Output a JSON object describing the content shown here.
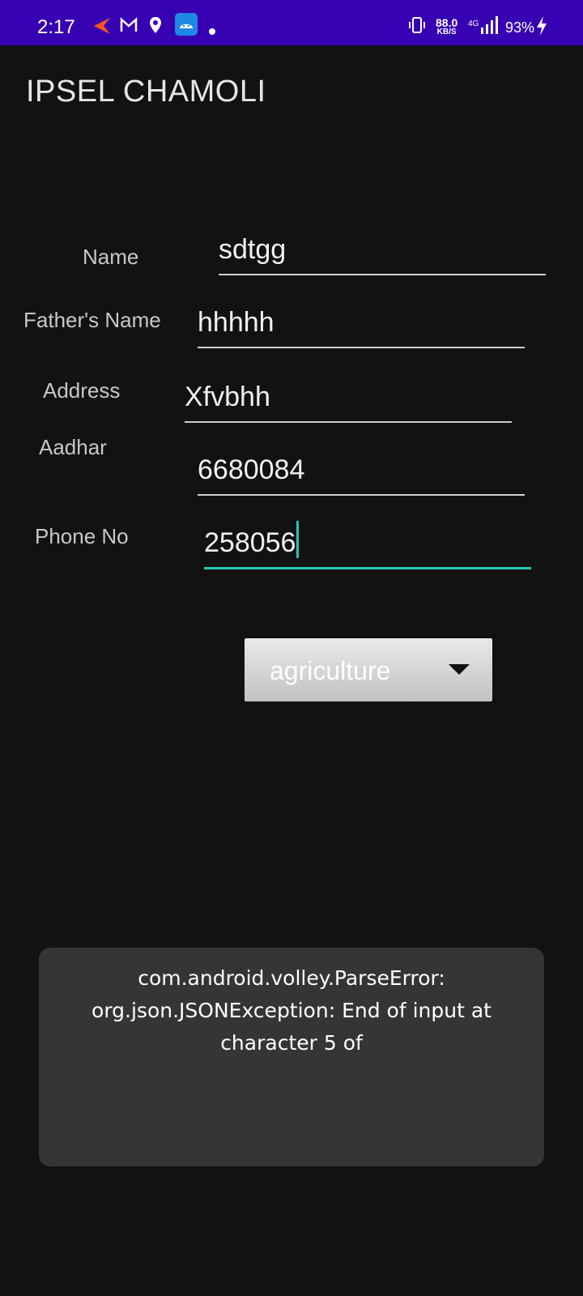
{
  "status_bar": {
    "time": "2:17",
    "net_speed_value": "88.0",
    "net_speed_unit": "KB/S",
    "network_type": "4G",
    "battery": "93%",
    "icons": [
      "kite-icon",
      "gmail-icon",
      "location-icon",
      "android-icon",
      "dot-icon",
      "vibrate-icon",
      "signal-icon",
      "charging-icon"
    ]
  },
  "app": {
    "title": "IPSEL CHAMOLI"
  },
  "form": {
    "name_label": "Name",
    "name_value": "sdtgg",
    "father_label": "Father's Name",
    "father_value": "hhhhh",
    "address_label": "Address",
    "address_value": "Xfvbhh",
    "aadhar_label": "Aadhar",
    "aadhar_value": "6680084",
    "phone_label": "Phone No",
    "phone_value": "258056",
    "category_selected": "agriculture"
  },
  "toast": {
    "line1": "com.android.volley.ParseError:",
    "line2": "org.json.JSONException: End of input at",
    "line3": "character 5 of"
  },
  "colors": {
    "status_bar": "#3700b3",
    "background": "#121212",
    "focus_accent": "#26c6b6",
    "toast_bg": "#353535"
  }
}
